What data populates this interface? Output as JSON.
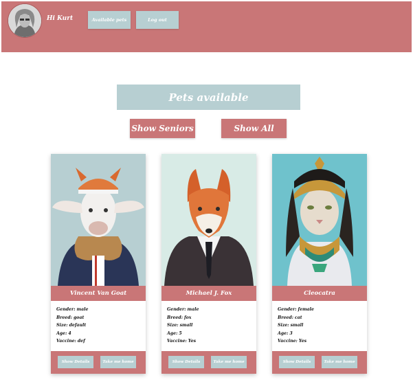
{
  "header": {
    "greeting": "Hi Kurt",
    "nav": [
      {
        "label": "Available pets"
      },
      {
        "label": "Log out"
      }
    ]
  },
  "main": {
    "title": "Pets available",
    "filters": {
      "seniors": "Show Seniors",
      "all": "Show All"
    }
  },
  "pets": [
    {
      "name": "Vincent Van Goat",
      "details": [
        {
          "key": "Gender:",
          "value": "male"
        },
        {
          "key": "Breed:",
          "value": "goat"
        },
        {
          "key": "Size:",
          "value": "default"
        },
        {
          "key": "Age:",
          "value": "4"
        },
        {
          "key": "Vaccine:",
          "value": "def"
        }
      ],
      "details_button": "Show Details",
      "home_button": "Take me home"
    },
    {
      "name": "Michael J. Fox",
      "details": [
        {
          "key": "Gender:",
          "value": "male"
        },
        {
          "key": "Breed:",
          "value": "fox"
        },
        {
          "key": "Size:",
          "value": "small"
        },
        {
          "key": "Age:",
          "value": "5"
        },
        {
          "key": "Vaccine:",
          "value": "Yes"
        }
      ],
      "details_button": "Show Details",
      "home_button": "Take me home"
    },
    {
      "name": "Cleocatra",
      "details": [
        {
          "key": "Gender:",
          "value": "female"
        },
        {
          "key": "Breed:",
          "value": "cat"
        },
        {
          "key": "Size:",
          "value": "small"
        },
        {
          "key": "Age:",
          "value": "3"
        },
        {
          "key": "Vaccine:",
          "value": "Yes"
        }
      ],
      "details_button": "Show Details",
      "home_button": "Take me home"
    }
  ],
  "colors": {
    "primary": "#c97677",
    "secondary": "#b7cfd2"
  }
}
